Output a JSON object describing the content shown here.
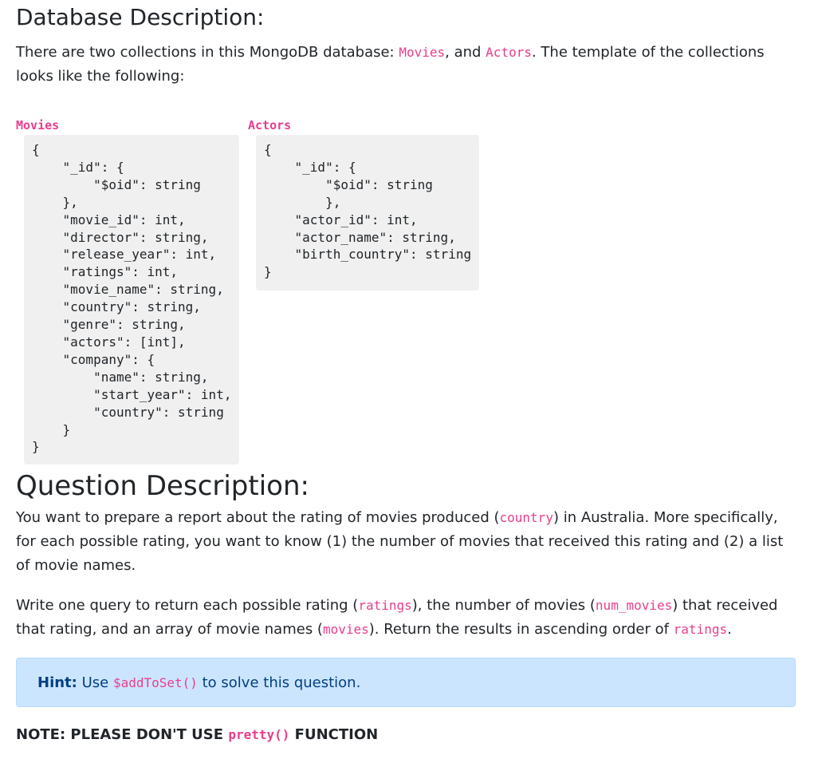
{
  "db_section": {
    "heading": "Database Description:",
    "intro_1": "There are two collections in this MongoDB database: ",
    "collection_1": "Movies",
    "intro_2": ", and ",
    "collection_2": "Actors",
    "intro_3": ". The template of the collections looks like the following:"
  },
  "schemas": {
    "movies": {
      "title": "Movies",
      "code": "{\n    \"_id\": {\n        \"$oid\": string\n    },\n    \"movie_id\": int,\n    \"director\": string,\n    \"release_year\": int,\n    \"ratings\": int,\n    \"movie_name\": string,\n    \"country\": string,\n    \"genre\": string,\n    \"actors\": [int],\n    \"company\": {\n        \"name\": string,\n        \"start_year\": int,\n        \"country\": string\n    }\n}"
    },
    "actors": {
      "title": "Actors",
      "code": "{\n    \"_id\": {\n        \"$oid\": string\n        },\n    \"actor_id\": int,\n    \"actor_name\": string,\n    \"birth_country\": string\n}"
    }
  },
  "question_section": {
    "heading": "Question Description:",
    "p1_a": "You want to prepare a report about the rating of movies produced (",
    "p1_code": "country",
    "p1_b": ") in Australia. More specifically, for each possible rating, you want to know (1) the number of movies that received this rating and (2) a list of movie names.",
    "p2_a": "Write one query to return each possible rating (",
    "p2_code1": "ratings",
    "p2_b": "), the number of movies (",
    "p2_code2": "num_movies",
    "p2_c": ") that received that rating, and an array of movie names (",
    "p2_code3": "movies",
    "p2_d": "). Return the results in ascending order of ",
    "p2_code4": "ratings",
    "p2_e": "."
  },
  "hint": {
    "label": "Hint:",
    "text_a": " Use ",
    "code": "$addToSet()",
    "text_b": " to solve this question."
  },
  "note": {
    "text_a": "NOTE: PLEASE DON'T USE ",
    "code": "pretty()",
    "text_b": " FUNCTION"
  },
  "colors": {
    "code_accent": "#e83e8c",
    "code_block_bg": "#f0f0f0",
    "hint_bg": "#cce5ff",
    "hint_text": "#004085"
  }
}
